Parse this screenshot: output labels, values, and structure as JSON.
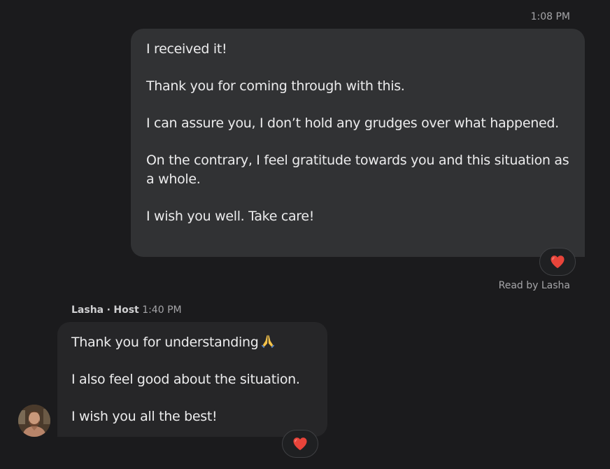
{
  "outgoing_message": {
    "time": "1:08 PM",
    "paragraphs": [
      "I received it!",
      "Thank you for coming through with this.",
      "I can assure you, I don’t hold any grudges over what happened.",
      "On the contrary, I feel gratitude towards you and this situation as a whole.",
      "I wish you well. Take care!"
    ],
    "reaction_icon": "heart-icon",
    "read_receipt": "Read by Lasha"
  },
  "incoming_message": {
    "sender_name": "Lasha",
    "sender_separator": "·",
    "sender_role": "Host",
    "time": "1:40 PM",
    "paragraphs": [
      "Thank you for understanding",
      "I also feel good about the situation.",
      "I wish you all the best!"
    ],
    "inline_emoji": "folded-hands-icon",
    "reaction_icon": "heart-icon",
    "avatar": "host-avatar"
  },
  "colors": {
    "background": "#1b1b1d",
    "outgoing_bubble": "#313234",
    "incoming_bubble": "#262628",
    "heart": "#e8443a",
    "muted_text": "#a5a5a8"
  }
}
